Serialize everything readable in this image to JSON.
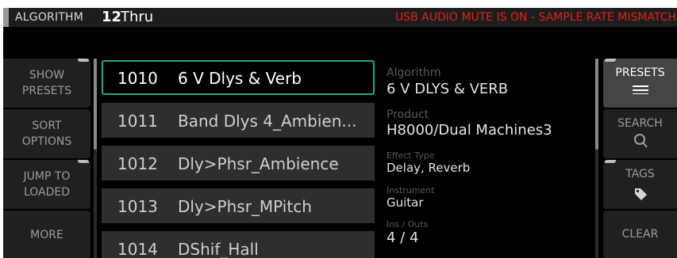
{
  "titlebar": {
    "label": "ALGORITHM",
    "algorithm_number": "12",
    "algorithm_name": "Thru",
    "warning": "USB AUDIO MUTE IS ON - SAMPLE RATE MISMATCH"
  },
  "left_buttons": [
    {
      "line1": "SHOW",
      "line2": "PRESETS"
    },
    {
      "line1": "SORT",
      "line2": "OPTIONS"
    },
    {
      "line1": "JUMP TO",
      "line2": "LOADED"
    },
    {
      "line1": "MORE",
      "line2": ""
    }
  ],
  "presets": [
    {
      "number": "1010",
      "name": "6 V Dlys & Verb",
      "selected": true
    },
    {
      "number": "1011",
      "name": "Band Dlys 4_Ambien...",
      "selected": false
    },
    {
      "number": "1012",
      "name": "Dly>Phsr_Ambience",
      "selected": false
    },
    {
      "number": "1013",
      "name": "Dly>Phsr_MPitch",
      "selected": false
    },
    {
      "number": "1014",
      "name": "DShif_Hall",
      "selected": false
    }
  ],
  "info": {
    "algorithm_label": "Algorithm",
    "algorithm_value": "6 V DLYS & VERB",
    "product_label": "Product",
    "product_value": "H8000/Dual Machines3",
    "effect_type_label": "Effect Type",
    "effect_type_value": "Delay, Reverb",
    "instrument_label": "Instrument",
    "instrument_value": "Guitar",
    "ins_outs_label": "Ins / Outs",
    "ins_outs_value": "4 / 4"
  },
  "right_buttons": {
    "presets": {
      "label": "PRESETS",
      "icon": "menu-lines-icon",
      "active": true
    },
    "search": {
      "label": "SEARCH",
      "icon": "magnifier-icon"
    },
    "tags": {
      "label": "TAGS",
      "icon": "tag-icon"
    },
    "clear": {
      "label": "CLEAR"
    }
  },
  "colors": {
    "selected_border": "#2aa987",
    "warning_text": "#e2211c",
    "background": "#000000"
  }
}
